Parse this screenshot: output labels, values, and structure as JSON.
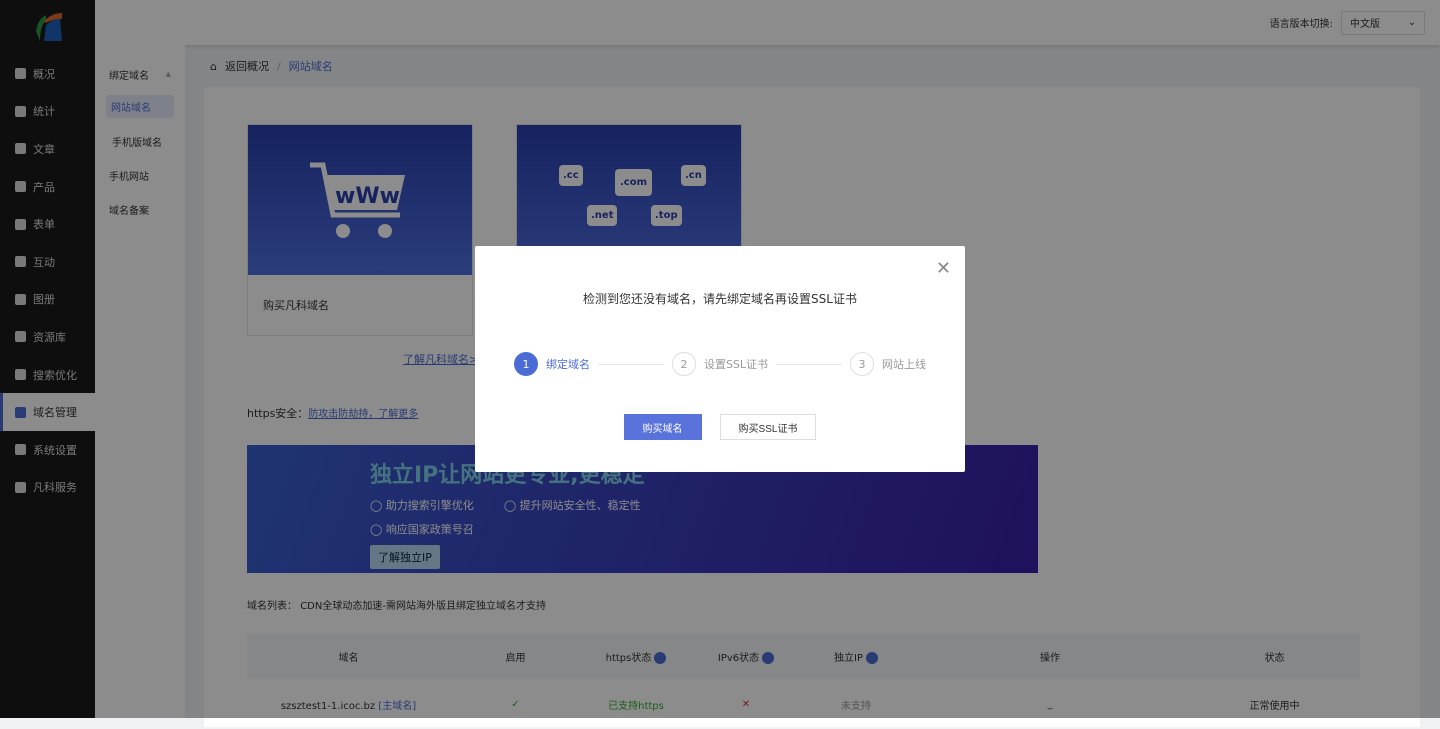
{
  "sidebar": {
    "items": [
      {
        "label": "概况",
        "icon": "home-icon"
      },
      {
        "label": "统计",
        "icon": "chart-icon"
      },
      {
        "label": "文章",
        "icon": "article-icon"
      },
      {
        "label": "产品",
        "icon": "grid-icon"
      },
      {
        "label": "表单",
        "icon": "form-icon"
      },
      {
        "label": "互动",
        "icon": "chat-icon"
      },
      {
        "label": "图册",
        "icon": "image-icon"
      },
      {
        "label": "资源库",
        "icon": "database-icon"
      },
      {
        "label": "搜索优化",
        "icon": "seo-icon"
      },
      {
        "label": "域名管理",
        "icon": "domain-icon",
        "active": true
      },
      {
        "label": "系统设置",
        "icon": "gear-icon"
      },
      {
        "label": "凡科服务",
        "icon": "heart-icon"
      }
    ]
  },
  "topbar": {
    "lang_label": "语言版本切换:",
    "lang_value": "中文版"
  },
  "subnav": {
    "group": "绑定域名",
    "items": [
      "网站域名",
      "手机版域名"
    ],
    "others": [
      "手机网站",
      "域名备案"
    ]
  },
  "breadcrumb": {
    "back": "返回概况",
    "current": "网站域名"
  },
  "cards": {
    "buy": "购买凡科域名",
    "learn": "了解凡科域名>",
    "domains": [
      ".cc",
      ".com",
      ".cn",
      ".net",
      ".top"
    ]
  },
  "https": {
    "label": "https安全：",
    "link": "防攻击防劫持，了解更多"
  },
  "banner": {
    "title": "独立IP让网站更专业,更稳定",
    "features": [
      "助力搜索引擎优化",
      "提升网站安全性、稳定性",
      "响应国家政策号召"
    ],
    "button": "了解独立IP"
  },
  "list": {
    "label": "域名列表：",
    "note": "CDN全球动态加速-需网站海外版且绑定独立域名才支持",
    "headers": [
      "域名",
      "启用",
      "https状态",
      "IPv6状态",
      "独立IP",
      "操作",
      "状态"
    ],
    "rows": [
      {
        "domain": "szsztest1-1.icoc.bz",
        "tag": "[主域名]",
        "enabled": "✓",
        "https": "已支持https",
        "ipv6": "✕",
        "ip": "未支持",
        "op": "_",
        "status": "正常使用中"
      }
    ]
  },
  "modal": {
    "message": "检测到您还没有域名，请先绑定域名再设置SSL证书",
    "steps": [
      {
        "num": "1",
        "label": "绑定域名"
      },
      {
        "num": "2",
        "label": "设置SSL证书"
      },
      {
        "num": "3",
        "label": "网站上线"
      }
    ],
    "primary": "购买域名",
    "secondary": "购买SSL证书"
  }
}
